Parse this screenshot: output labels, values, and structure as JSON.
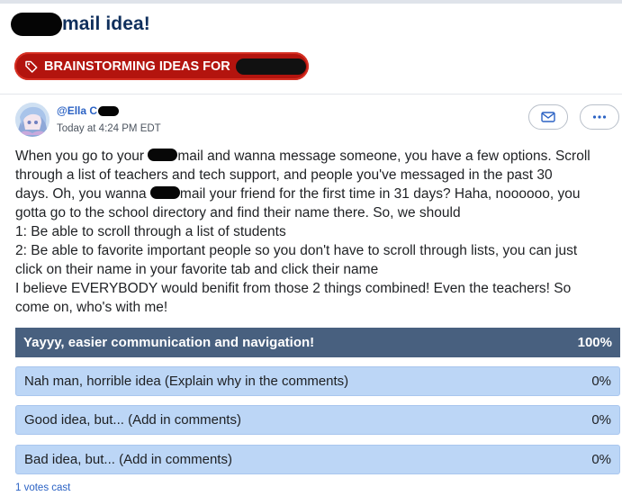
{
  "post": {
    "title": "mail idea!",
    "tag_label": "BRAINSTORMING IDEAS FOR",
    "author": "@Ella C",
    "timestamp": "Today at 4:24 PM EDT"
  },
  "body_lines": [
    {
      "pre": "When you go to your ",
      "post": "mail and wanna message someone, you have a few options. Scroll"
    },
    {
      "pre": "through a list of teachers and tech support, and people you've messaged in the past 30",
      "post": ""
    },
    {
      "pre": "days. Oh, you wanna ",
      "post": "mail your friend for the first time in 31 days? Haha, noooooo, you"
    },
    {
      "pre": "gotta go to the school directory and find their name there. So, we should",
      "post": ""
    },
    {
      "pre": "1: Be able to scroll through a list of students",
      "post": ""
    },
    {
      "pre": "2: Be able to favorite important people so you don't have to scroll through lists, you can just",
      "post": ""
    },
    {
      "pre": "click on their name in your favorite tab and click their name",
      "post": ""
    },
    {
      "pre": "I believe EVERYBODY would benifit from those 2 things combined! Even the teachers! So",
      "post": ""
    },
    {
      "pre": "come on, who's with me!",
      "post": ""
    }
  ],
  "poll": {
    "options": [
      {
        "label": "Yayyy, easier communication and navigation!",
        "percent": "100%"
      },
      {
        "label": "Nah man, horrible idea (Explain why in the comments)",
        "percent": "0%"
      },
      {
        "label": "Good idea, but... (Add in comments)",
        "percent": "0%"
      },
      {
        "label": "Bad idea, but... (Add in comments)",
        "percent": "0%"
      }
    ],
    "votes_cast": "1 votes cast"
  },
  "icons": {
    "tag": "tag-icon",
    "mail": "mail-icon",
    "more": "more-horizontal-icon"
  },
  "colors": {
    "tag_bg": "#b3140e",
    "title": "#0f2f5c",
    "link": "#2b62c4",
    "poll_winner": "#48607f",
    "poll_option": "#bcd6f6"
  }
}
